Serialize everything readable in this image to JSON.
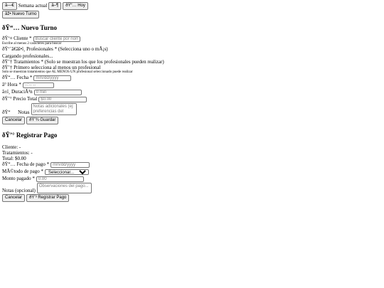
{
  "toolbar": {
    "prev_label": "â—€",
    "week_label": "Semana actual",
    "next_label": "â–¶",
    "today_label": "ðŸ“… Hoy",
    "new_turn_label": "âž• Nuevo Turno"
  },
  "new_turn": {
    "title": "ðŸ“… Nuevo Turno",
    "client_label": "ðŸ‘¤ Cliente *",
    "client_placeholder": "Buscar cliente por nombre",
    "client_hint": "Escribe al menos 2 caracteres para buscar",
    "professionals_label": "ðŸ‘¨â€âš•ï¸ Profesionales * (Selecciona uno o mÃ¡s)",
    "loading_text": "Cargando profesionales...",
    "treatments_label": "ðŸ’† Tratamientos * (Solo se muestran los que los profesionales pueden realizar)",
    "treatments_empty": "ðŸ’† Primero selecciona al menos un profesional",
    "treatments_hint": "Solo se muestran tratamientos que AL MENOS UN profesional seleccionado puede realizar",
    "date_label": "ðŸ“… Fecha *",
    "date_placeholder": "mm/dd/yyyy",
    "time_label": "â° Hora *",
    "time_placeholder": "--:-- --",
    "duration_label": "â±ï¸ DuraciÃ³n",
    "duration_placeholder": "0 min",
    "price_label": "ðŸ’° Precio Total",
    "price_placeholder": "$0.00",
    "notes_label": "ðŸ“      Notas",
    "notes_placeholder": "Notas adicionales (ej: preferencias del cliente...)",
    "cancel_label": "Cancelar",
    "save_label": "ðŸ’¾ Guardar"
  },
  "payment": {
    "title": "ðŸ’° Registrar Pago",
    "client_text": "Cliente: -",
    "treatments_text": "Tratamientos: -",
    "total_text": "Total: $0.00",
    "date_label": "ðŸ“… Fecha de pago *",
    "date_placeholder": "mm/dd/yyyy",
    "method_label": "MÃ©todo de pago *",
    "method_selected": "Seleccionar...",
    "amount_label": "Monto pagado *",
    "amount_placeholder": "0.00",
    "notes_label": "Notas (opcional)",
    "notes_placeholder": "Observaciones del pago...",
    "cancel_label": "Cancelar",
    "submit_label": "ðŸ’³ Registrar Pago"
  }
}
